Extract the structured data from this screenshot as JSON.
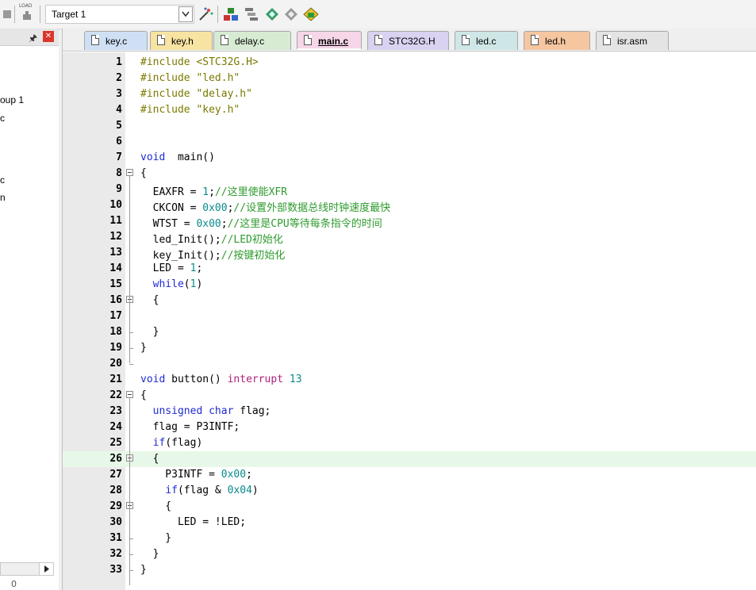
{
  "toolbar": {
    "target": "Target 1",
    "load_icon_label": "LOAD"
  },
  "project_panel": {
    "items": [
      "oup 1",
      "c",
      "c",
      "n"
    ],
    "bottom_text": "0"
  },
  "tabs": [
    {
      "label": "key.c",
      "color": "#cfe0f5",
      "active": false
    },
    {
      "label": "key.h",
      "color": "#f7e3a2",
      "active": false
    },
    {
      "label": "delay.c",
      "color": "#d7ebd3",
      "active": false
    },
    {
      "label": "main.c",
      "color": "#f6d6e8",
      "active": true
    },
    {
      "label": "STC32G.H",
      "color": "#d9d2f0",
      "active": false
    },
    {
      "label": "led.c",
      "color": "#cfe6e6",
      "active": false
    },
    {
      "label": "led.h",
      "color": "#f5c6a0",
      "active": false
    },
    {
      "label": "isr.asm",
      "color": "#e4e4e4",
      "active": false
    }
  ],
  "code": {
    "highlight_line": 26,
    "lines": [
      {
        "n": "1",
        "segs": [
          [
            "pp",
            "#include "
          ],
          [
            "str",
            "<STC32G.H>"
          ]
        ]
      },
      {
        "n": "2",
        "segs": [
          [
            "pp",
            "#include "
          ],
          [
            "str",
            "\"led.h\""
          ]
        ]
      },
      {
        "n": "3",
        "segs": [
          [
            "pp",
            "#include "
          ],
          [
            "str",
            "\"delay.h\""
          ]
        ]
      },
      {
        "n": "4",
        "segs": [
          [
            "pp",
            "#include "
          ],
          [
            "str",
            "\"key.h\""
          ]
        ]
      },
      {
        "n": "5",
        "segs": []
      },
      {
        "n": "6",
        "segs": []
      },
      {
        "n": "7",
        "segs": [
          [
            "kw",
            "void"
          ],
          [
            "",
            "  main()"
          ]
        ]
      },
      {
        "n": "8",
        "segs": [
          [
            "",
            "{"
          ]
        ]
      },
      {
        "n": "9",
        "segs": [
          [
            "",
            "  EAXFR = "
          ],
          [
            "num",
            "1"
          ],
          [
            "",
            ";"
          ],
          [
            "cmt",
            "//这里使能XFR"
          ]
        ]
      },
      {
        "n": "10",
        "segs": [
          [
            "",
            "  CKCON = "
          ],
          [
            "num",
            "0x00"
          ],
          [
            "",
            ";"
          ],
          [
            "cmt",
            "//设置外部数据总线时钟速度最快"
          ]
        ]
      },
      {
        "n": "11",
        "segs": [
          [
            "",
            "  WTST = "
          ],
          [
            "num",
            "0x00"
          ],
          [
            "",
            ";"
          ],
          [
            "cmt",
            "//这里是CPU等待每条指令的时间"
          ]
        ]
      },
      {
        "n": "12",
        "segs": [
          [
            "",
            "  led_Init();"
          ],
          [
            "cmt",
            "//LED初始化"
          ]
        ]
      },
      {
        "n": "13",
        "segs": [
          [
            "",
            "  key_Init();"
          ],
          [
            "cmt",
            "//按键初始化"
          ]
        ]
      },
      {
        "n": "14",
        "segs": [
          [
            "",
            "  LED = "
          ],
          [
            "num",
            "1"
          ],
          [
            "",
            ";"
          ]
        ]
      },
      {
        "n": "15",
        "segs": [
          [
            "",
            "  "
          ],
          [
            "kw",
            "while"
          ],
          [
            "",
            "("
          ],
          [
            "num",
            "1"
          ],
          [
            "",
            ")"
          ]
        ]
      },
      {
        "n": "16",
        "segs": [
          [
            "",
            "  {"
          ]
        ]
      },
      {
        "n": "17",
        "segs": []
      },
      {
        "n": "18",
        "segs": [
          [
            "",
            "  }"
          ]
        ]
      },
      {
        "n": "19",
        "segs": [
          [
            "",
            "}"
          ]
        ]
      },
      {
        "n": "20",
        "segs": []
      },
      {
        "n": "21",
        "segs": [
          [
            "kw",
            "void"
          ],
          [
            "",
            " button() "
          ],
          [
            "kw2",
            "interrupt"
          ],
          [
            "",
            " "
          ],
          [
            "num",
            "13"
          ]
        ]
      },
      {
        "n": "22",
        "segs": [
          [
            "",
            "{"
          ]
        ]
      },
      {
        "n": "23",
        "segs": [
          [
            "",
            "  "
          ],
          [
            "kw",
            "unsigned"
          ],
          [
            "",
            " "
          ],
          [
            "kw",
            "char"
          ],
          [
            "",
            " flag;"
          ]
        ]
      },
      {
        "n": "24",
        "segs": [
          [
            "",
            "  flag = P3INTF;"
          ]
        ]
      },
      {
        "n": "25",
        "segs": [
          [
            "",
            "  "
          ],
          [
            "kw",
            "if"
          ],
          [
            "",
            "(flag)"
          ]
        ]
      },
      {
        "n": "26",
        "segs": [
          [
            "",
            "  {"
          ]
        ]
      },
      {
        "n": "27",
        "segs": [
          [
            "",
            "    P3INTF = "
          ],
          [
            "num",
            "0x00"
          ],
          [
            "",
            ";"
          ]
        ]
      },
      {
        "n": "28",
        "segs": [
          [
            "",
            "    "
          ],
          [
            "kw",
            "if"
          ],
          [
            "",
            "(flag & "
          ],
          [
            "num",
            "0x04"
          ],
          [
            "",
            ")"
          ]
        ]
      },
      {
        "n": "29",
        "segs": [
          [
            "",
            "    {"
          ]
        ]
      },
      {
        "n": "30",
        "segs": [
          [
            "",
            "      LED = !LED;"
          ]
        ]
      },
      {
        "n": "31",
        "segs": [
          [
            "",
            "    }"
          ]
        ]
      },
      {
        "n": "32",
        "segs": [
          [
            "",
            "  }"
          ]
        ]
      },
      {
        "n": "33",
        "segs": [
          [
            "",
            "}"
          ]
        ]
      }
    ]
  }
}
